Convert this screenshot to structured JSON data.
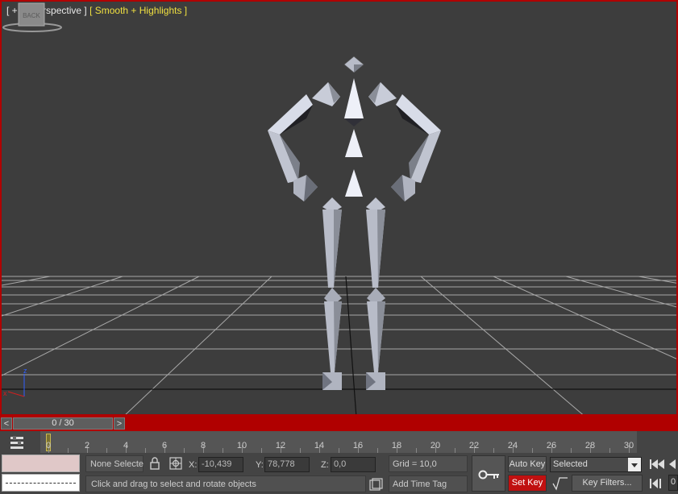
{
  "viewport": {
    "label_plus": "[ + ]",
    "label_view": "[ Perspective ]",
    "label_shading": "[ Smooth + Highlights ]",
    "navcube_face": "BACK",
    "axis_z": "z",
    "axis_x": "x",
    "border_color": "#b00000"
  },
  "timeslider": {
    "prev_label": "<",
    "next_label": ">",
    "value": "0 / 30"
  },
  "trackbar": {
    "ticks": [
      "0",
      "2",
      "4",
      "6",
      "8",
      "10",
      "12",
      "14",
      "16",
      "18",
      "20",
      "22",
      "24",
      "26",
      "28",
      "30"
    ]
  },
  "status": {
    "selection": "None Selected",
    "x_label": "X:",
    "x_value": "-10,439",
    "y_label": "Y:",
    "y_value": "78,778",
    "z_label": "Z:",
    "z_value": "0,0",
    "grid": "Grid = 10,0",
    "prompt": "Click and drag to select and rotate objects",
    "add_time_tag": "Add Time Tag",
    "auto_key": "Auto Key",
    "set_key": "Set Key",
    "key_mode": "Selected",
    "key_filters": "Key Filters...",
    "frame_field": "0"
  }
}
